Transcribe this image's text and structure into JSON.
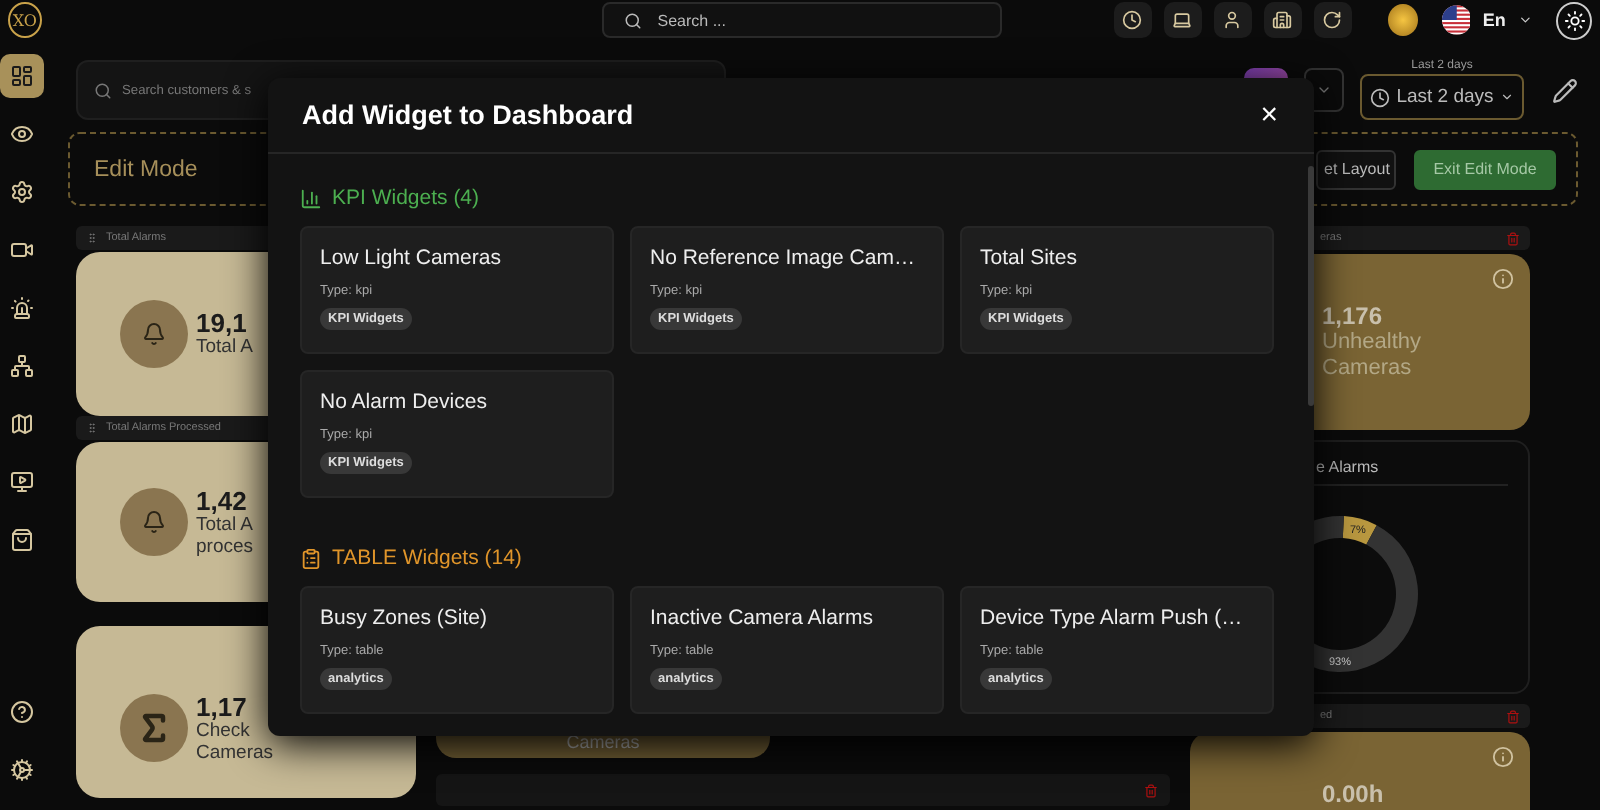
{
  "top_bar": {
    "logo": "XO",
    "search": {
      "placeholder": "Search ..."
    },
    "language": "En"
  },
  "sidebar": {
    "items": [
      {
        "selected": true
      },
      {
        "selected": false
      },
      {
        "selected": false
      },
      {
        "selected": false
      },
      {
        "selected": false
      },
      {
        "selected": false
      },
      {
        "selected": false
      },
      {
        "selected": false
      },
      {
        "selected": false
      }
    ],
    "bottom_items": [
      {
        "selected": false
      },
      {
        "selected": false
      }
    ]
  },
  "toolbar": {
    "search": {
      "placeholder": "Search customers & s"
    },
    "date_range": {
      "label": "Last 2 days",
      "value": "Last 2 days"
    }
  },
  "edit_bar": {
    "title": "Edit Mode",
    "buttons": [
      {
        "label": "et Layout",
        "kind": "outline"
      },
      {
        "label": "Exit Edit Mode",
        "kind": "primary"
      }
    ]
  },
  "left_widgets": [
    {
      "header": "Total Alarms",
      "value": "19,1",
      "label_lines": [
        "Total A"
      ]
    },
    {
      "header": "Total Alarms Processed",
      "value": "1,42",
      "label_lines": [
        "Total A",
        "proces"
      ]
    },
    {
      "value": "1,17",
      "label_lines": [
        "Check",
        "Cameras"
      ]
    }
  ],
  "middle_widget": {
    "label": "Cameras"
  },
  "right_widgets": [
    {
      "kind": "kpi",
      "header": "eras",
      "value": "1,176",
      "label_lines": [
        "Unhealthy",
        "Cameras"
      ]
    },
    {
      "kind": "chart",
      "title": "e Alarms",
      "chart_data": {
        "type": "donut",
        "values": [
          7,
          93
        ],
        "value_labels": [
          "7%",
          "93%"
        ]
      }
    },
    {
      "kind": "kpi",
      "header": "ed",
      "value": "0.00h"
    }
  ],
  "modal": {
    "title": "Add Widget to Dashboard",
    "close": "×",
    "sections": [
      {
        "title": "KPI Widgets (4)",
        "color": "#4caf50",
        "widgets": [
          {
            "name": "Low Light Cameras",
            "type": "Type: kpi",
            "tag": "KPI Widgets"
          },
          {
            "name": "No Reference Image Cam…",
            "type": "Type: kpi",
            "tag": "KPI Widgets"
          },
          {
            "name": "Total Sites",
            "type": "Type: kpi",
            "tag": "KPI Widgets"
          },
          {
            "name": "No Alarm Devices",
            "type": "Type: kpi",
            "tag": "KPI Widgets"
          }
        ]
      },
      {
        "title": "TABLE Widgets (14)",
        "color": "#e0952a",
        "widgets": [
          {
            "name": "Busy Zones (Site)",
            "type": "Type: table",
            "tag": "analytics"
          },
          {
            "name": "Inactive Camera Alarms",
            "type": "Type: table",
            "tag": "analytics"
          },
          {
            "name": "Device Type Alarm Push (…",
            "type": "Type: table",
            "tag": "analytics"
          }
        ]
      }
    ]
  }
}
